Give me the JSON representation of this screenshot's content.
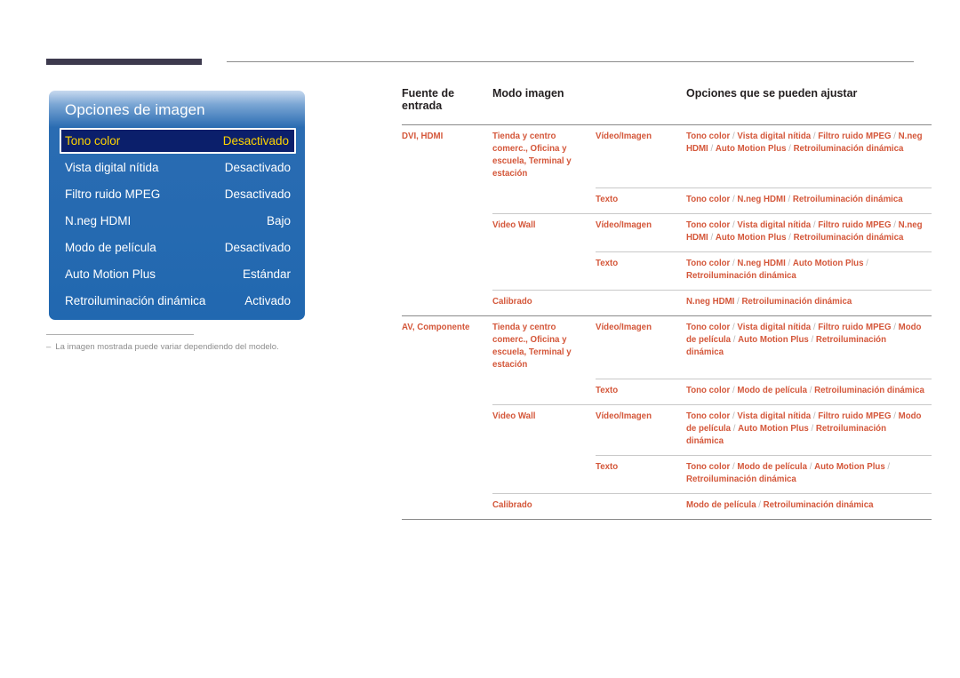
{
  "osd": {
    "title": "Opciones de imagen",
    "rows": [
      {
        "label": "Tono color",
        "value": "Desactivado",
        "selected": true
      },
      {
        "label": "Vista digital nítida",
        "value": "Desactivado",
        "selected": false
      },
      {
        "label": "Filtro ruido MPEG",
        "value": "Desactivado",
        "selected": false
      },
      {
        "label": "N.neg HDMI",
        "value": "Bajo",
        "selected": false
      },
      {
        "label": "Modo de película",
        "value": "Desactivado",
        "selected": false
      },
      {
        "label": "Auto Motion Plus",
        "value": "Estándar",
        "selected": false
      },
      {
        "label": "Retroiluminación dinámica",
        "value": "Activado",
        "selected": false
      }
    ],
    "highlight_bg": "#0b1f6b",
    "highlight_text": "#ffd400",
    "panel_blue": "#2168b0"
  },
  "footnote": {
    "dash": "–",
    "text": "La imagen mostrada puede variar dependiendo del modelo."
  },
  "table": {
    "accent_color": "#d4573a",
    "headers": {
      "source": "Fuente de entrada",
      "mode": "Modo imagen",
      "sub": "",
      "options": "Opciones que se pueden ajustar"
    },
    "rows": [
      {
        "source": "DVI, HDMI",
        "mode": "Tienda y centro comerc., Oficina y escuela, Terminal y estación",
        "sub": "Vídeo/Imagen",
        "options": "Tono color / Vista digital nítida / Filtro ruido MPEG / N.neg HDMI / Auto Motion Plus / Retroiluminación dinámica"
      },
      {
        "source": "",
        "mode": "",
        "sub": "Texto",
        "options": "Tono color / N.neg HDMI / Retroiluminación dinámica"
      },
      {
        "source": "",
        "mode": "Video Wall",
        "sub": "Vídeo/Imagen",
        "options": "Tono color / Vista digital nítida / Filtro ruido MPEG / N.neg HDMI / Auto Motion Plus / Retroiluminación dinámica"
      },
      {
        "source": "",
        "mode": "",
        "sub": "Texto",
        "options": "Tono color / N.neg HDMI / Auto Motion Plus / Retroiluminación dinámica"
      },
      {
        "source": "",
        "mode": "Calibrado",
        "sub": "",
        "options": "N.neg HDMI / Retroiluminación dinámica"
      },
      {
        "source": "AV, Componente",
        "mode": "Tienda y centro comerc., Oficina y escuela, Terminal y estación",
        "sub": "Vídeo/Imagen",
        "options": "Tono color / Vista digital nítida / Filtro ruido MPEG / Modo de película / Auto Motion Plus / Retroiluminación dinámica"
      },
      {
        "source": "",
        "mode": "",
        "sub": "Texto",
        "options": "Tono color / Modo de película / Retroiluminación dinámica"
      },
      {
        "source": "",
        "mode": "Video Wall",
        "sub": "Vídeo/Imagen",
        "options": "Tono color / Vista digital nítida / Filtro ruido MPEG / Modo de película / Auto Motion Plus / Retroiluminación dinámica"
      },
      {
        "source": "",
        "mode": "",
        "sub": "Texto",
        "options": "Tono color / Modo de película / Auto Motion Plus / Retroiluminación dinámica"
      },
      {
        "source": "",
        "mode": "Calibrado",
        "sub": "",
        "options": "Modo de película / Retroiluminación dinámica"
      }
    ]
  }
}
